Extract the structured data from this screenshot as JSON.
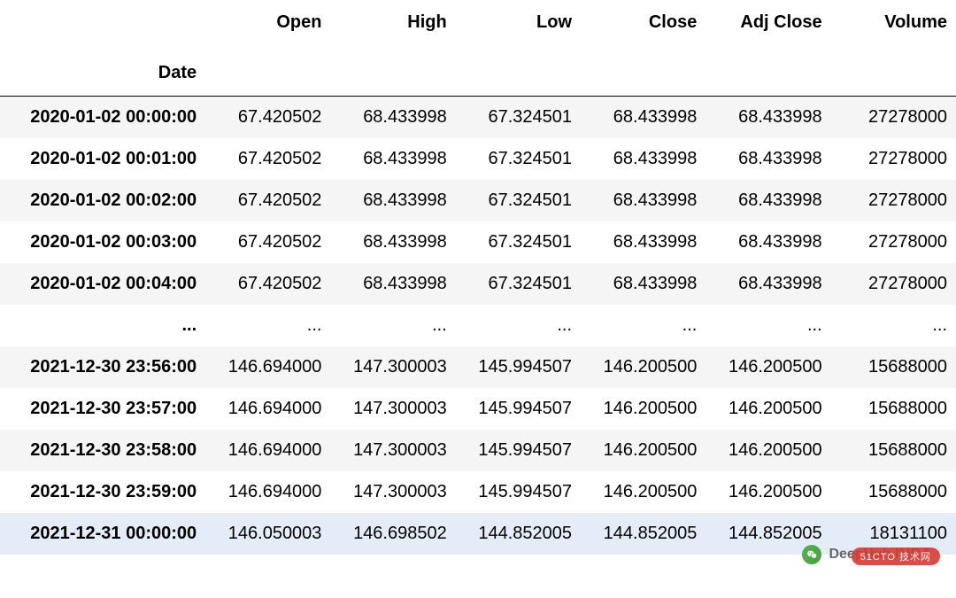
{
  "chart_data": {
    "type": "table",
    "index_name": "Date",
    "columns": [
      "Open",
      "High",
      "Low",
      "Close",
      "Adj Close",
      "Volume"
    ],
    "ellipsis": "...",
    "rows": [
      {
        "index": "2020-01-02 00:00:00",
        "cells": [
          "67.420502",
          "68.433998",
          "67.324501",
          "68.433998",
          "68.433998",
          "27278000"
        ],
        "stripe": true
      },
      {
        "index": "2020-01-02 00:01:00",
        "cells": [
          "67.420502",
          "68.433998",
          "67.324501",
          "68.433998",
          "68.433998",
          "27278000"
        ],
        "stripe": false
      },
      {
        "index": "2020-01-02 00:02:00",
        "cells": [
          "67.420502",
          "68.433998",
          "67.324501",
          "68.433998",
          "68.433998",
          "27278000"
        ],
        "stripe": true
      },
      {
        "index": "2020-01-02 00:03:00",
        "cells": [
          "67.420502",
          "68.433998",
          "67.324501",
          "68.433998",
          "68.433998",
          "27278000"
        ],
        "stripe": false
      },
      {
        "index": "2020-01-02 00:04:00",
        "cells": [
          "67.420502",
          "68.433998",
          "67.324501",
          "68.433998",
          "68.433998",
          "27278000"
        ],
        "stripe": true
      },
      {
        "ellipsis": true
      },
      {
        "index": "2021-12-30 23:56:00",
        "cells": [
          "146.694000",
          "147.300003",
          "145.994507",
          "146.200500",
          "146.200500",
          "15688000"
        ],
        "stripe": true
      },
      {
        "index": "2021-12-30 23:57:00",
        "cells": [
          "146.694000",
          "147.300003",
          "145.994507",
          "146.200500",
          "146.200500",
          "15688000"
        ],
        "stripe": false
      },
      {
        "index": "2021-12-30 23:58:00",
        "cells": [
          "146.694000",
          "147.300003",
          "145.994507",
          "146.200500",
          "146.200500",
          "15688000"
        ],
        "stripe": true
      },
      {
        "index": "2021-12-30 23:59:00",
        "cells": [
          "146.694000",
          "147.300003",
          "145.994507",
          "146.200500",
          "146.200500",
          "15688000"
        ],
        "stripe": false
      },
      {
        "index": "2021-12-31 00:00:00",
        "cells": [
          "146.050003",
          "146.698502",
          "144.852005",
          "144.852005",
          "144.852005",
          "18131100"
        ],
        "highlight": true
      }
    ]
  },
  "watermark": {
    "text": "DeepHub IMBA",
    "badge": "51CTO 技术网"
  }
}
